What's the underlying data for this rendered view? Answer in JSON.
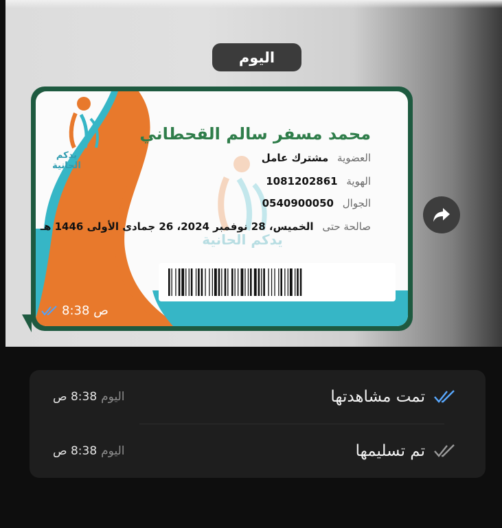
{
  "chat": {
    "date_label": "اليوم",
    "message_time": "8:38 ص",
    "status_icon": "double-check-blue"
  },
  "card": {
    "logo_text": "يدكم الحانية",
    "name": "محمد مسفر سالم القحطاني",
    "membership_label": "العضوية",
    "membership_value": "مشترك عامل",
    "id_label": "الهوية",
    "id_value": "1081202861",
    "mobile_label": "الجوال",
    "mobile_value": "0540900050",
    "valid_label": "صالحة حتى",
    "valid_value": "الخميس، 28 نوفمبر 2024، 26 جمادى الأولى 1446 هـ",
    "watermark_text": "يدكم الحانية",
    "colors": {
      "orange": "#e8792c",
      "teal": "#36b6c6",
      "green": "#2f7d4a"
    }
  },
  "info": {
    "seen_label": "تمت مشاهدتها",
    "seen_day": "اليوم",
    "seen_time": "8:38 ص",
    "delivered_label": "تم تسليمها",
    "delivered_day": "اليوم",
    "delivered_time": "8:38 ص",
    "seen_color": "#5aa9ff",
    "delivered_color": "#9a9a9a"
  }
}
